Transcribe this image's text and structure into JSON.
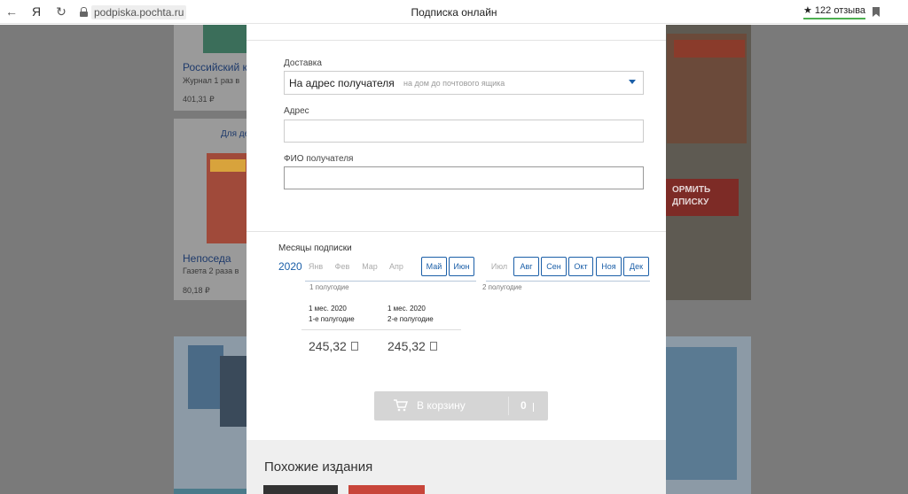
{
  "browser": {
    "url": "podpiska.pochta.ru",
    "tab_title": "Подписка онлайн",
    "reviews": "★ 122 отзыва",
    "yandex_glyph": "Я",
    "back_glyph": "←",
    "reload_glyph": "↻"
  },
  "background": {
    "item1_title": "Российский к",
    "item1_desc": "Журнал 1 раз в",
    "item1_price": "401,31 ₽",
    "item2_badge": "Для де",
    "item2_title": "Непоседа",
    "item2_desc": "Газета 2 раза в",
    "item2_price": "80,18 ₽",
    "promo_text": "ОРМИТЬ\nДПИСКУ"
  },
  "form": {
    "delivery_label": "Доставка",
    "delivery_value": "На адрес получателя",
    "delivery_hint": "на дом до почтового ящика",
    "address_label": "Адрес",
    "address_value": "",
    "fio_label": "ФИО получателя",
    "fio_value": ""
  },
  "subscription": {
    "months_label": "Месяцы подписки",
    "year": "2020",
    "months": [
      {
        "name": "Янв",
        "selected": false
      },
      {
        "name": "Фев",
        "selected": false
      },
      {
        "name": "Мар",
        "selected": false
      },
      {
        "name": "Апр",
        "selected": false
      },
      {
        "name": "Май",
        "selected": true
      },
      {
        "name": "Июн",
        "selected": true
      },
      {
        "name": "Июл",
        "selected": false
      },
      {
        "name": "Авг",
        "selected": true
      },
      {
        "name": "Сен",
        "selected": true
      },
      {
        "name": "Окт",
        "selected": true
      },
      {
        "name": "Ноя",
        "selected": true
      },
      {
        "name": "Дек",
        "selected": true
      }
    ],
    "half1_label": "1 полугодие",
    "half2_label": "2 полугодие",
    "periods": [
      {
        "duration": "1 мес. 2020",
        "half": "1-е полугодие",
        "price": "245,32"
      },
      {
        "duration": "1 мес. 2020",
        "half": "2-е полугодие",
        "price": "245,32"
      }
    ]
  },
  "cart": {
    "label": "В корзину",
    "count": "0"
  },
  "similar": {
    "title": "Похожие издания"
  },
  "colors": {
    "accent": "#1b5fa8",
    "overlay": "#7a7a7a",
    "button_disabled": "#d5d5d5"
  }
}
